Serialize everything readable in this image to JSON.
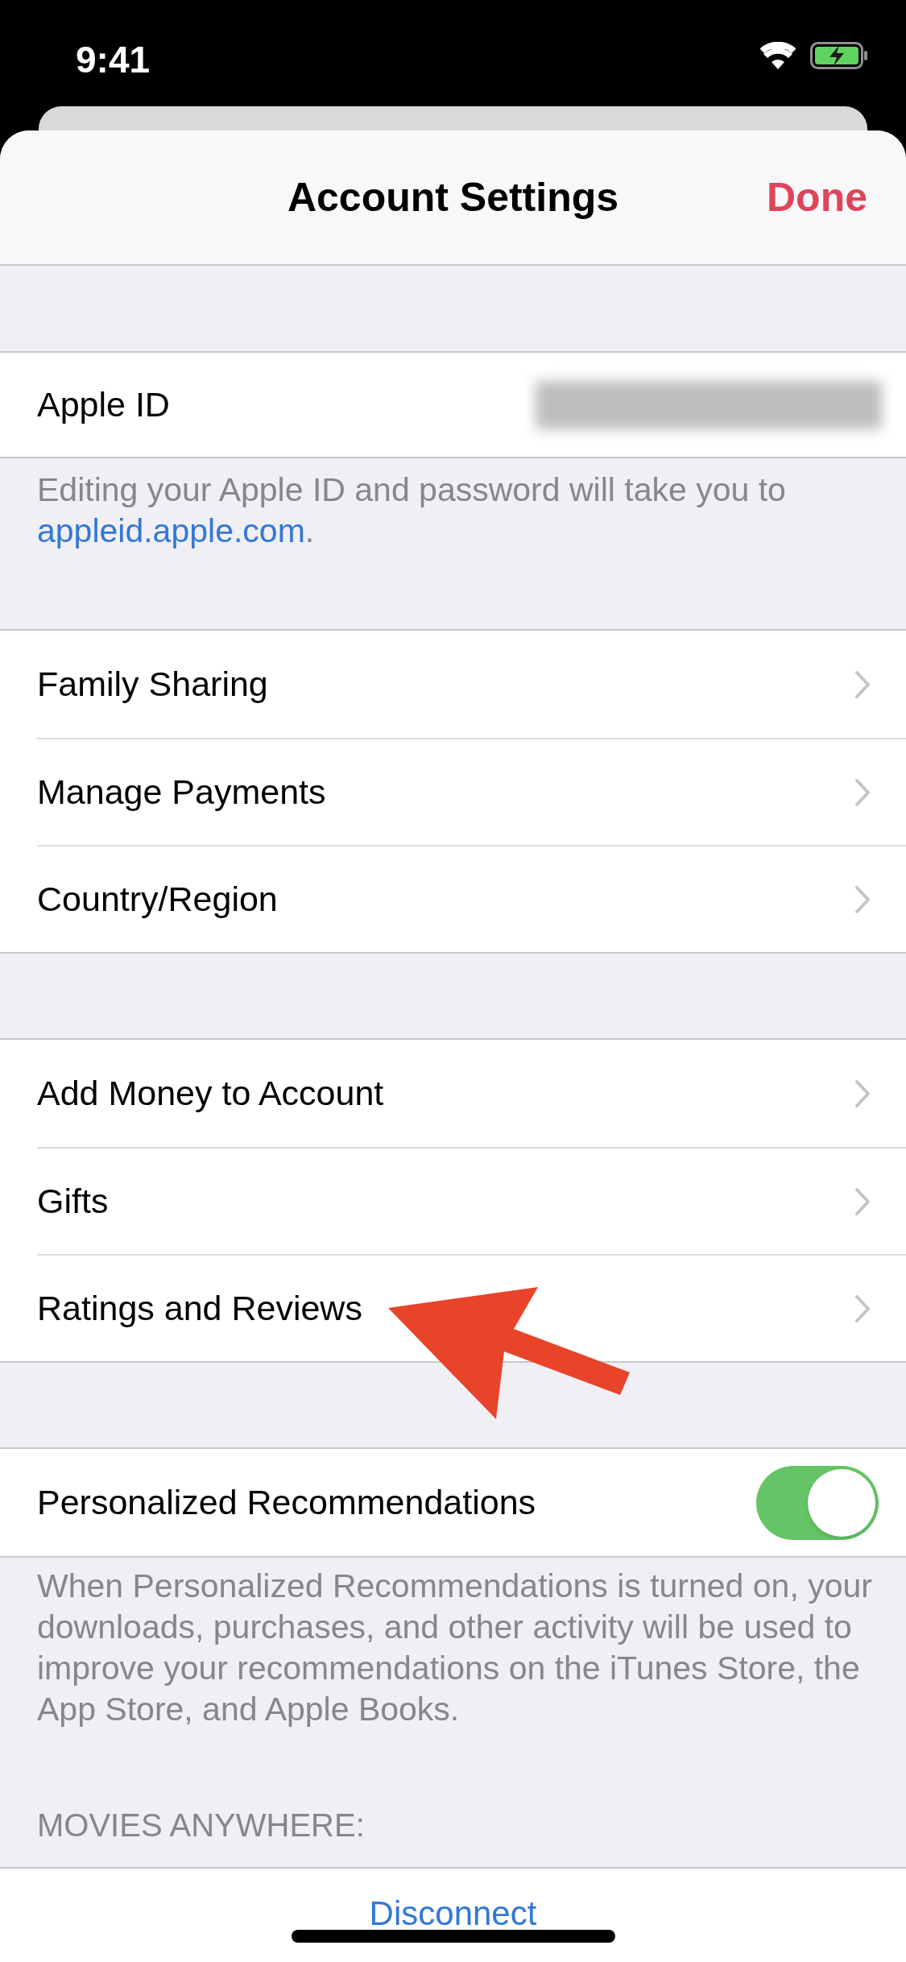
{
  "status_bar": {
    "time": "9:41"
  },
  "nav": {
    "title": "Account Settings",
    "done": "Done"
  },
  "apple_id": {
    "label": "Apple ID"
  },
  "apple_id_footer": {
    "text": "Editing your Apple ID and password will take you to ",
    "link": "appleid.apple.com",
    "after": "."
  },
  "groups": [
    [
      {
        "kind": "link",
        "label": "Family Sharing"
      },
      {
        "kind": "link",
        "label": "Manage Payments"
      },
      {
        "kind": "link",
        "label": "Country/Region"
      }
    ],
    [
      {
        "kind": "link",
        "label": "Add Money to Account"
      },
      {
        "kind": "link",
        "label": "Gifts"
      },
      {
        "kind": "link",
        "label": "Ratings and Reviews"
      }
    ],
    [
      {
        "kind": "toggle",
        "label": "Personalized Recommendations",
        "on": true
      }
    ]
  ],
  "recommendations_footer": "When Personalized Recommendations is turned on, your downloads, purchases, and other activity will be used to improve your recommendations on the iTunes Store, the App Store, and Apple Books.",
  "section_header": "MOVIES ANYWHERE:",
  "disconnect": "Disconnect"
}
